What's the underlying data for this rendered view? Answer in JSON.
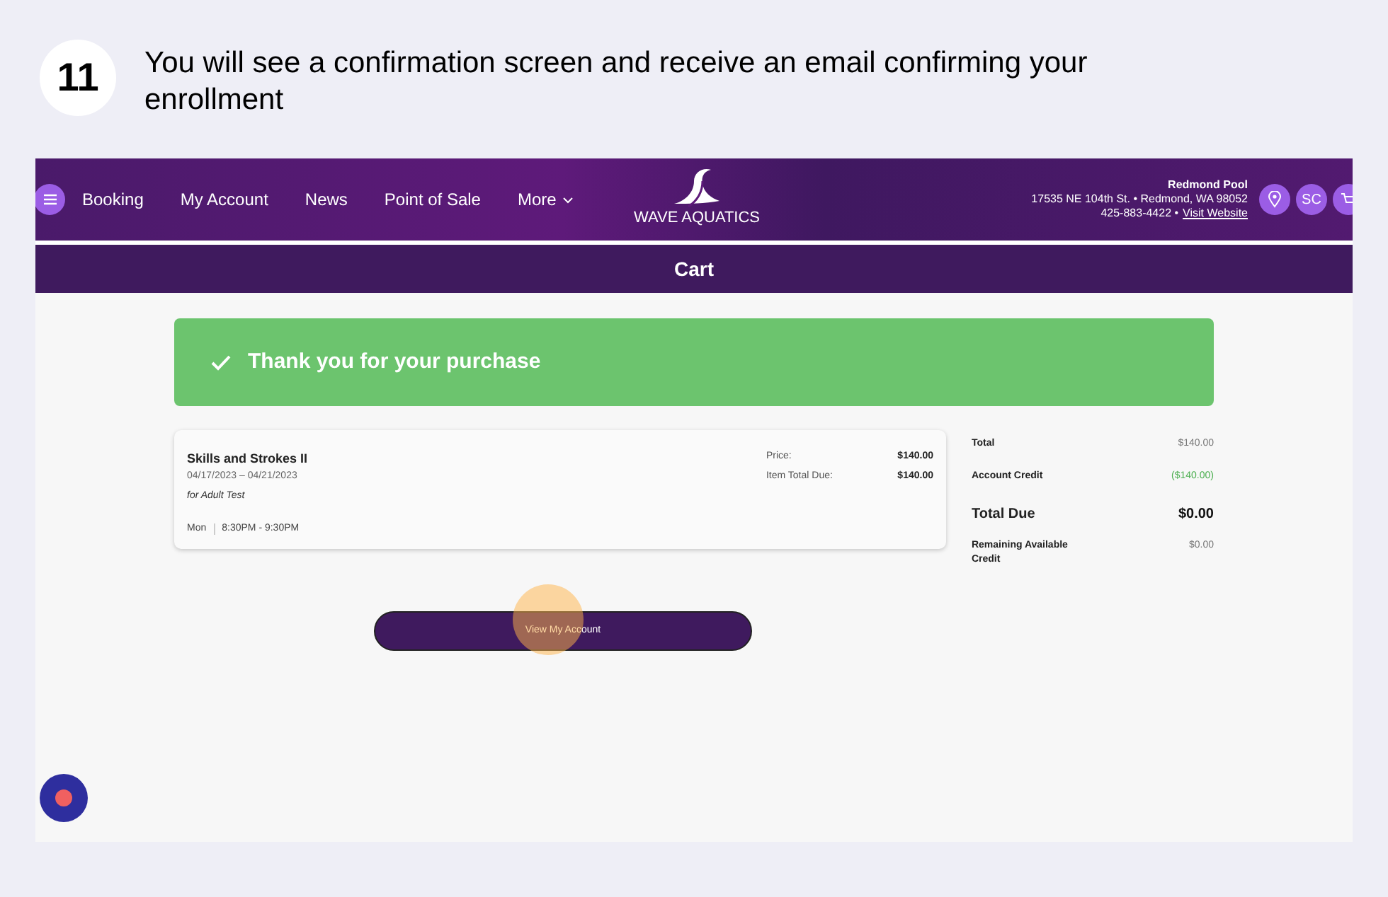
{
  "step": {
    "number": "11",
    "text": "You will see a confirmation screen and receive an email confirming your enrollment"
  },
  "nav": {
    "items": [
      {
        "label": "Booking"
      },
      {
        "label": "My Account"
      },
      {
        "label": "News"
      },
      {
        "label": "Point of Sale"
      },
      {
        "label": "More",
        "dropdown": true
      }
    ],
    "logo": "WAVE AQUATICS",
    "location": {
      "name": "Redmond Pool",
      "address": "17535 NE 104th St. • Redmond, WA 98052",
      "phone": "425-883-4422 •",
      "link": "Visit Website"
    },
    "avatar": "SC"
  },
  "page_title": "Cart",
  "banner": "Thank you for your purchase",
  "item": {
    "name": "Skills and Strokes II",
    "dates": "04/17/2023 – 04/21/2023",
    "for": "for Adult Test",
    "day": "Mon",
    "time": "8:30PM - 9:30PM",
    "prices": [
      {
        "label": "Price:",
        "value": "$140.00"
      },
      {
        "label": "Item Total Due:",
        "value": "$140.00"
      }
    ]
  },
  "summary": [
    {
      "label": "Total",
      "value": "$140.00",
      "kind": "normal"
    },
    {
      "label": "Account Credit",
      "value": "($140.00)",
      "kind": "credit"
    },
    {
      "label": "Total Due",
      "value": "$0.00",
      "kind": "big"
    },
    {
      "label": "Remaining Available Credit",
      "value": "$0.00",
      "kind": "normal"
    }
  ],
  "button": "View My Account"
}
